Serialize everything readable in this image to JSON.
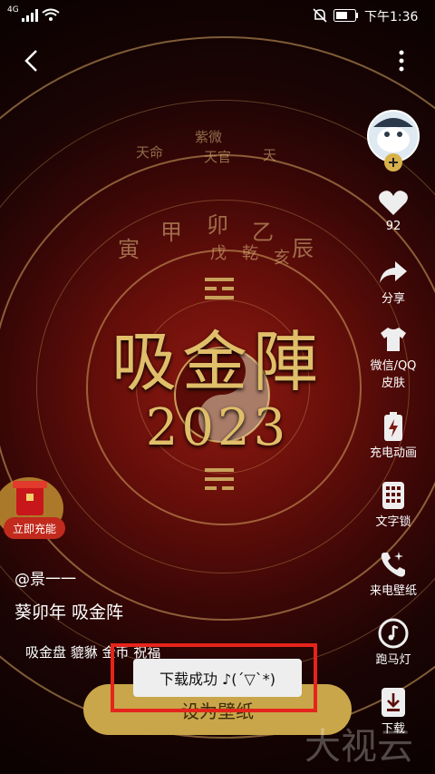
{
  "status_bar": {
    "network": "4G",
    "time": "下午1:36"
  },
  "wallpaper": {
    "title_main": "吸金陣",
    "title_year": "2023",
    "inner_glyphs": [
      "甲",
      "卯",
      "乙",
      "辰",
      "寅",
      "戊",
      "乾",
      "亥"
    ],
    "outer_glyphs": [
      "天官",
      "天",
      "紫微",
      "天命"
    ]
  },
  "side_panel": {
    "like_count": "92",
    "share_label": "分享",
    "wechat_qq_skin_label_1": "微信/QQ",
    "wechat_qq_skin_label_2": "皮肤",
    "charging_anim_label": "充电动画",
    "text_lock_label": "文字锁",
    "call_wallpaper_label": "来电壁纸",
    "marquee_label": "跑马灯",
    "download_label": "下载"
  },
  "promo": {
    "label": "立即充能"
  },
  "post": {
    "author": "@景一一",
    "title": "葵卯年 吸金阵",
    "tags": "吸金盘 貔貅 金币 祝福"
  },
  "actions": {
    "set_wallpaper": "设为壁纸"
  },
  "toast": {
    "message": "下载成功 ♪(´▽`*)"
  },
  "watermark": "大视云"
}
